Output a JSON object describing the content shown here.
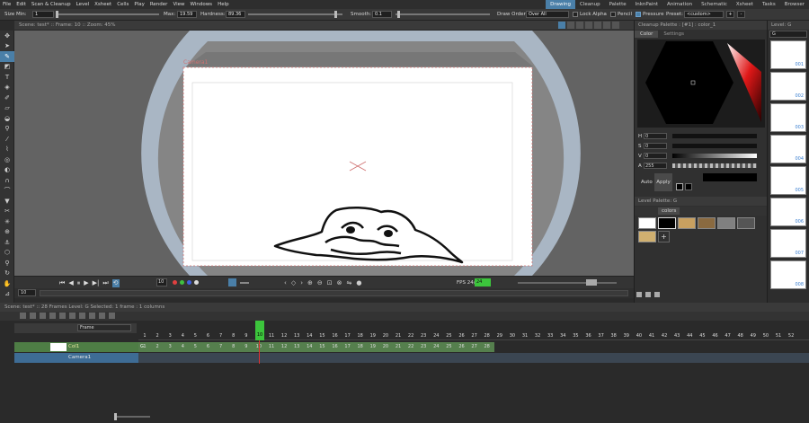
{
  "menu": [
    "File",
    "Edit",
    "Scan & Cleanup",
    "Level",
    "Xsheet",
    "Cells",
    "Play",
    "Render",
    "View",
    "Windows",
    "Help"
  ],
  "rooms": [
    {
      "label": "Drawing",
      "active": true
    },
    {
      "label": "Cleanup",
      "active": false
    },
    {
      "label": "Palette",
      "active": false
    },
    {
      "label": "InknPaint",
      "active": false
    },
    {
      "label": "Animation",
      "active": false
    },
    {
      "label": "Schematic",
      "active": false
    },
    {
      "label": "Xsheet",
      "active": false
    },
    {
      "label": "Tasks",
      "active": false
    },
    {
      "label": "Browser",
      "active": false
    }
  ],
  "tool_options": {
    "size_min_label": "Size Min:",
    "size_min_value": "1",
    "max_label": "Max:",
    "max_value": "19.59",
    "hardness_label": "Hardness:",
    "hardness_value": "89.36",
    "smooth_label": "Smooth:",
    "smooth_value": "0.1",
    "draw_order_label": "Draw Order:",
    "draw_order_value": "Over All",
    "lock_alpha_label": "Lock Alpha",
    "lock_alpha": false,
    "pencil_label": "Pencil",
    "pencil": false,
    "pressure_label": "Pressure",
    "pressure": true,
    "preset_label": "Preset:",
    "preset_value": "<custom>",
    "preset_add": "+",
    "preset_remove": "-"
  },
  "viewer": {
    "header": "Scene: test*  ::  Frame: 10  ::  Zoom: 45%",
    "camera_label": "Camera1",
    "fps_label": "FPS 24/",
    "fps_value": "24",
    "frame_field": "10",
    "frame_field2": "10"
  },
  "style_editor": {
    "title": "Cleanup Palette : [#1] : color_1",
    "tabs": [
      "Color",
      "Settings"
    ],
    "channels": [
      {
        "label": "H",
        "value": "0"
      },
      {
        "label": "S",
        "value": "0"
      },
      {
        "label": "V",
        "value": "0"
      },
      {
        "label": "A",
        "value": "255"
      }
    ],
    "auto_label": "Auto",
    "apply_label": "Apply"
  },
  "level_palette": {
    "title": "Level Palette: G",
    "tab_label": "colors",
    "add_label": "+"
  },
  "level_strip": {
    "title": "Level: G",
    "field_value": "G",
    "frames": [
      "001",
      "002",
      "003",
      "004",
      "005",
      "006",
      "007",
      "008",
      "009"
    ]
  },
  "xsheet": {
    "header": "Scene: test*  ::  28 Frames  Level: G  Selected: 1 frame : 1 columns",
    "frame_dropdown": "Frame",
    "columns": [
      {
        "name": "Col1",
        "level": "G"
      },
      {
        "name": "Camera1",
        "level": ""
      }
    ],
    "current_frame": "10",
    "frame_numbers": [
      "1",
      "2",
      "3",
      "4",
      "5",
      "6",
      "7",
      "8",
      "9",
      "10",
      "11",
      "12",
      "13",
      "14",
      "15",
      "16",
      "17",
      "18",
      "19",
      "20",
      "21",
      "22",
      "23",
      "24",
      "25",
      "26",
      "27",
      "28",
      "29",
      "30",
      "31",
      "32",
      "33",
      "34",
      "35",
      "36",
      "37",
      "38",
      "39",
      "40",
      "41",
      "42",
      "43",
      "44",
      "45",
      "46",
      "47",
      "48",
      "49",
      "50",
      "51",
      "52"
    ],
    "cell_numbers": [
      "1",
      "2",
      "3",
      "4",
      "5",
      "6",
      "7",
      "8",
      "9",
      "10",
      "11",
      "12",
      "13",
      "14",
      "15",
      "16",
      "17",
      "18",
      "19",
      "20",
      "21",
      "22",
      "23",
      "24",
      "25",
      "26",
      "27",
      "28"
    ]
  },
  "colors": {
    "accent": "#4a7fa8",
    "green_frame": "#3cc53c",
    "col_green": "#4e7d45",
    "camera_blue": "#3e6c95"
  }
}
